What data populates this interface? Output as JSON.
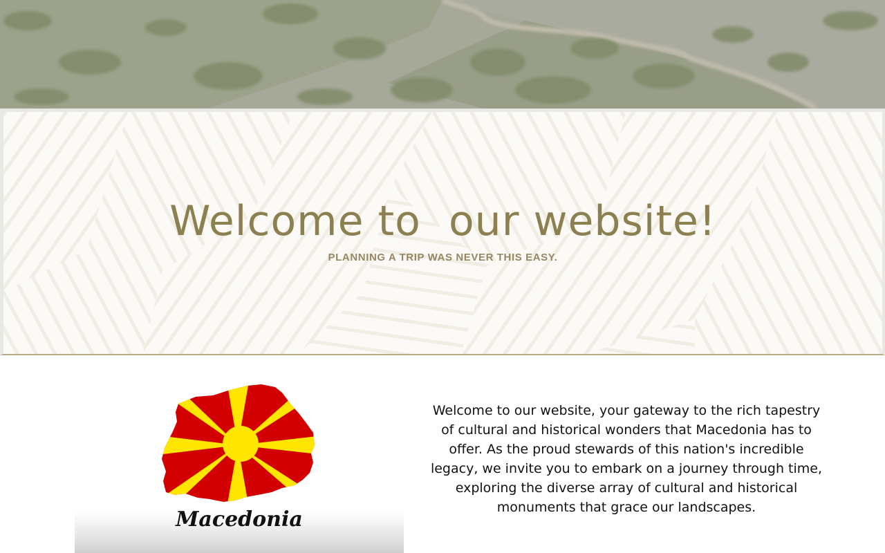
{
  "hero": {
    "image": "mountain-landscape-photo"
  },
  "welcome": {
    "title": "Welcome to  our website!",
    "subtitle": "PLANNING A TRIP WAS NEVER THIS EASY."
  },
  "map": {
    "label": "Macedonia",
    "icon": "macedonia-flag-map-icon",
    "colors": {
      "red": "#d20000",
      "yellow": "#ffe600"
    }
  },
  "intro": {
    "text": "Welcome to our website, your gateway to the rich tapestry of cultural and historical wonders that Macedonia has to offer. As the proud stewards of this nation's incredible legacy, we invite you to embark on a journey through time, exploring the diverse array of cultural and historical monuments that grace our landscapes."
  },
  "colors": {
    "accent_gold": "#8c7f50",
    "panel_bg": "#fbfaf7",
    "text": "#111111"
  }
}
